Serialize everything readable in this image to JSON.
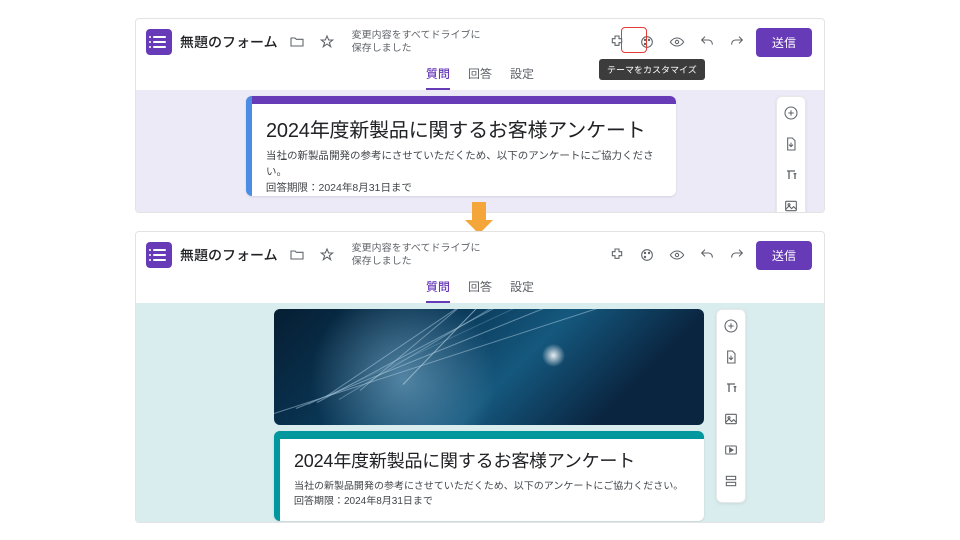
{
  "header": {
    "title": "無題のフォーム",
    "save_line1": "変更内容をすべてドライブに",
    "save_line2": "保存しました",
    "send": "送信",
    "tooltip": "テーマをカスタマイズ"
  },
  "tabs": {
    "q": "質問",
    "a": "回答",
    "s": "設定"
  },
  "form": {
    "title": "2024年度新製品に関するお客様アンケート",
    "desc1": "当社の新製品開発の参考にさせていただくため、以下のアンケートにご協力ください。",
    "desc2": "回答期限：2024年8月31日まで"
  },
  "colors": {
    "purple_accent": "#673ab7",
    "purple_left": "#4b8de3",
    "teal_accent": "#00979d",
    "teal_left": "#00979d"
  },
  "icons": {
    "folder": "folder-icon",
    "star": "star-icon",
    "addon": "addon-icon",
    "palette": "palette-icon",
    "eye": "preview-icon",
    "undo": "undo-icon",
    "redo": "redo-icon",
    "plus": "add-question-icon",
    "import": "import-icon",
    "text": "title-icon",
    "image": "image-icon",
    "video": "video-icon",
    "section": "section-icon"
  }
}
